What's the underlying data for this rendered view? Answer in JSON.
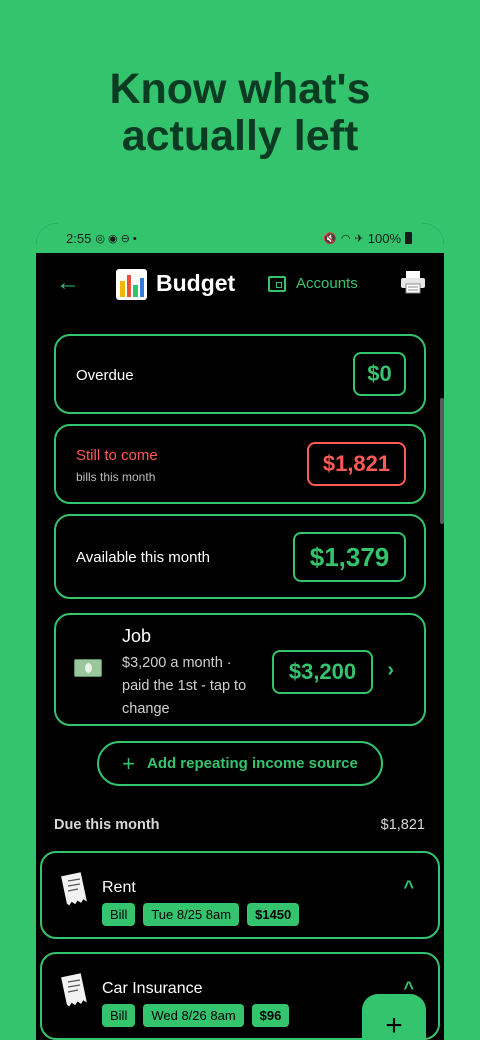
{
  "promo": {
    "line1": "Know what's",
    "line2": "actually left"
  },
  "status": {
    "time": "2:55",
    "battery": "100%"
  },
  "appbar": {
    "title": "Budget",
    "accounts_label": "Accounts"
  },
  "cards": {
    "overdue": {
      "label": "Overdue",
      "amount": "$0"
    },
    "still_to_come": {
      "label": "Still to come",
      "sublabel": "bills this month",
      "amount": "$1,821"
    },
    "available": {
      "label": "Available this month",
      "amount": "$1,379"
    },
    "job": {
      "title": "Job",
      "description": "$3,200 a month · paid the 1st - tap to change",
      "amount": "$3,200"
    }
  },
  "add_income_label": "Add repeating income source",
  "due": {
    "label": "Due this month",
    "total": "$1,821"
  },
  "bills": [
    {
      "name": "Rent",
      "type": "Bill",
      "date": "Tue 8/25 8am",
      "amount": "$1450"
    },
    {
      "name": "Car Insurance",
      "type": "Bill",
      "date": "Wed 8/26 8am",
      "amount": "$96"
    }
  ],
  "colors": {
    "accent": "#34c46e",
    "danger": "#ff5a55",
    "background": "#000000"
  }
}
